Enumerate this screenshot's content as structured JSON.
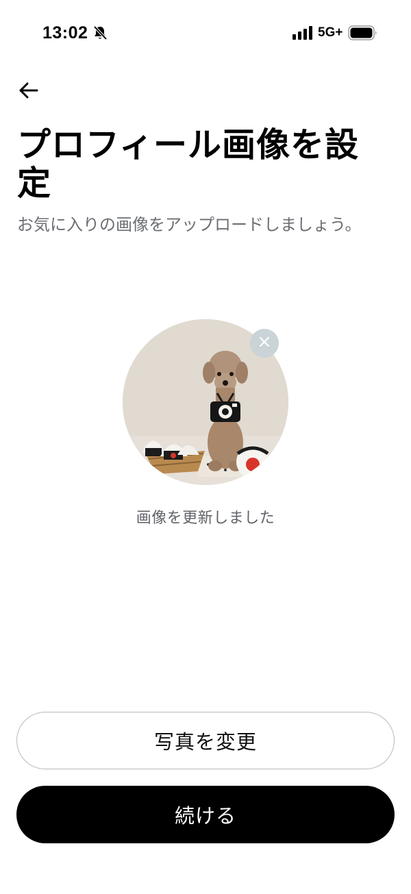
{
  "status_bar": {
    "time": "13:02",
    "network": "5G+",
    "icons": [
      "bell-off-icon",
      "signal-icon",
      "battery-icon"
    ]
  },
  "header": {
    "back_icon": "arrow-left-icon",
    "title": "プロフィール画像を設定",
    "subtitle": "お気に入りの画像をアップロードしましょう。"
  },
  "avatar": {
    "remove_icon": "close-icon",
    "status_message": "画像を更新しました"
  },
  "actions": {
    "change_photo_label": "写真を変更",
    "continue_label": "続ける"
  },
  "colors": {
    "primary": "#000000",
    "subtitle_text": "#6b6e73",
    "remove_button_bg": "#c9d3d8",
    "outline_border": "#b7b9bc"
  }
}
